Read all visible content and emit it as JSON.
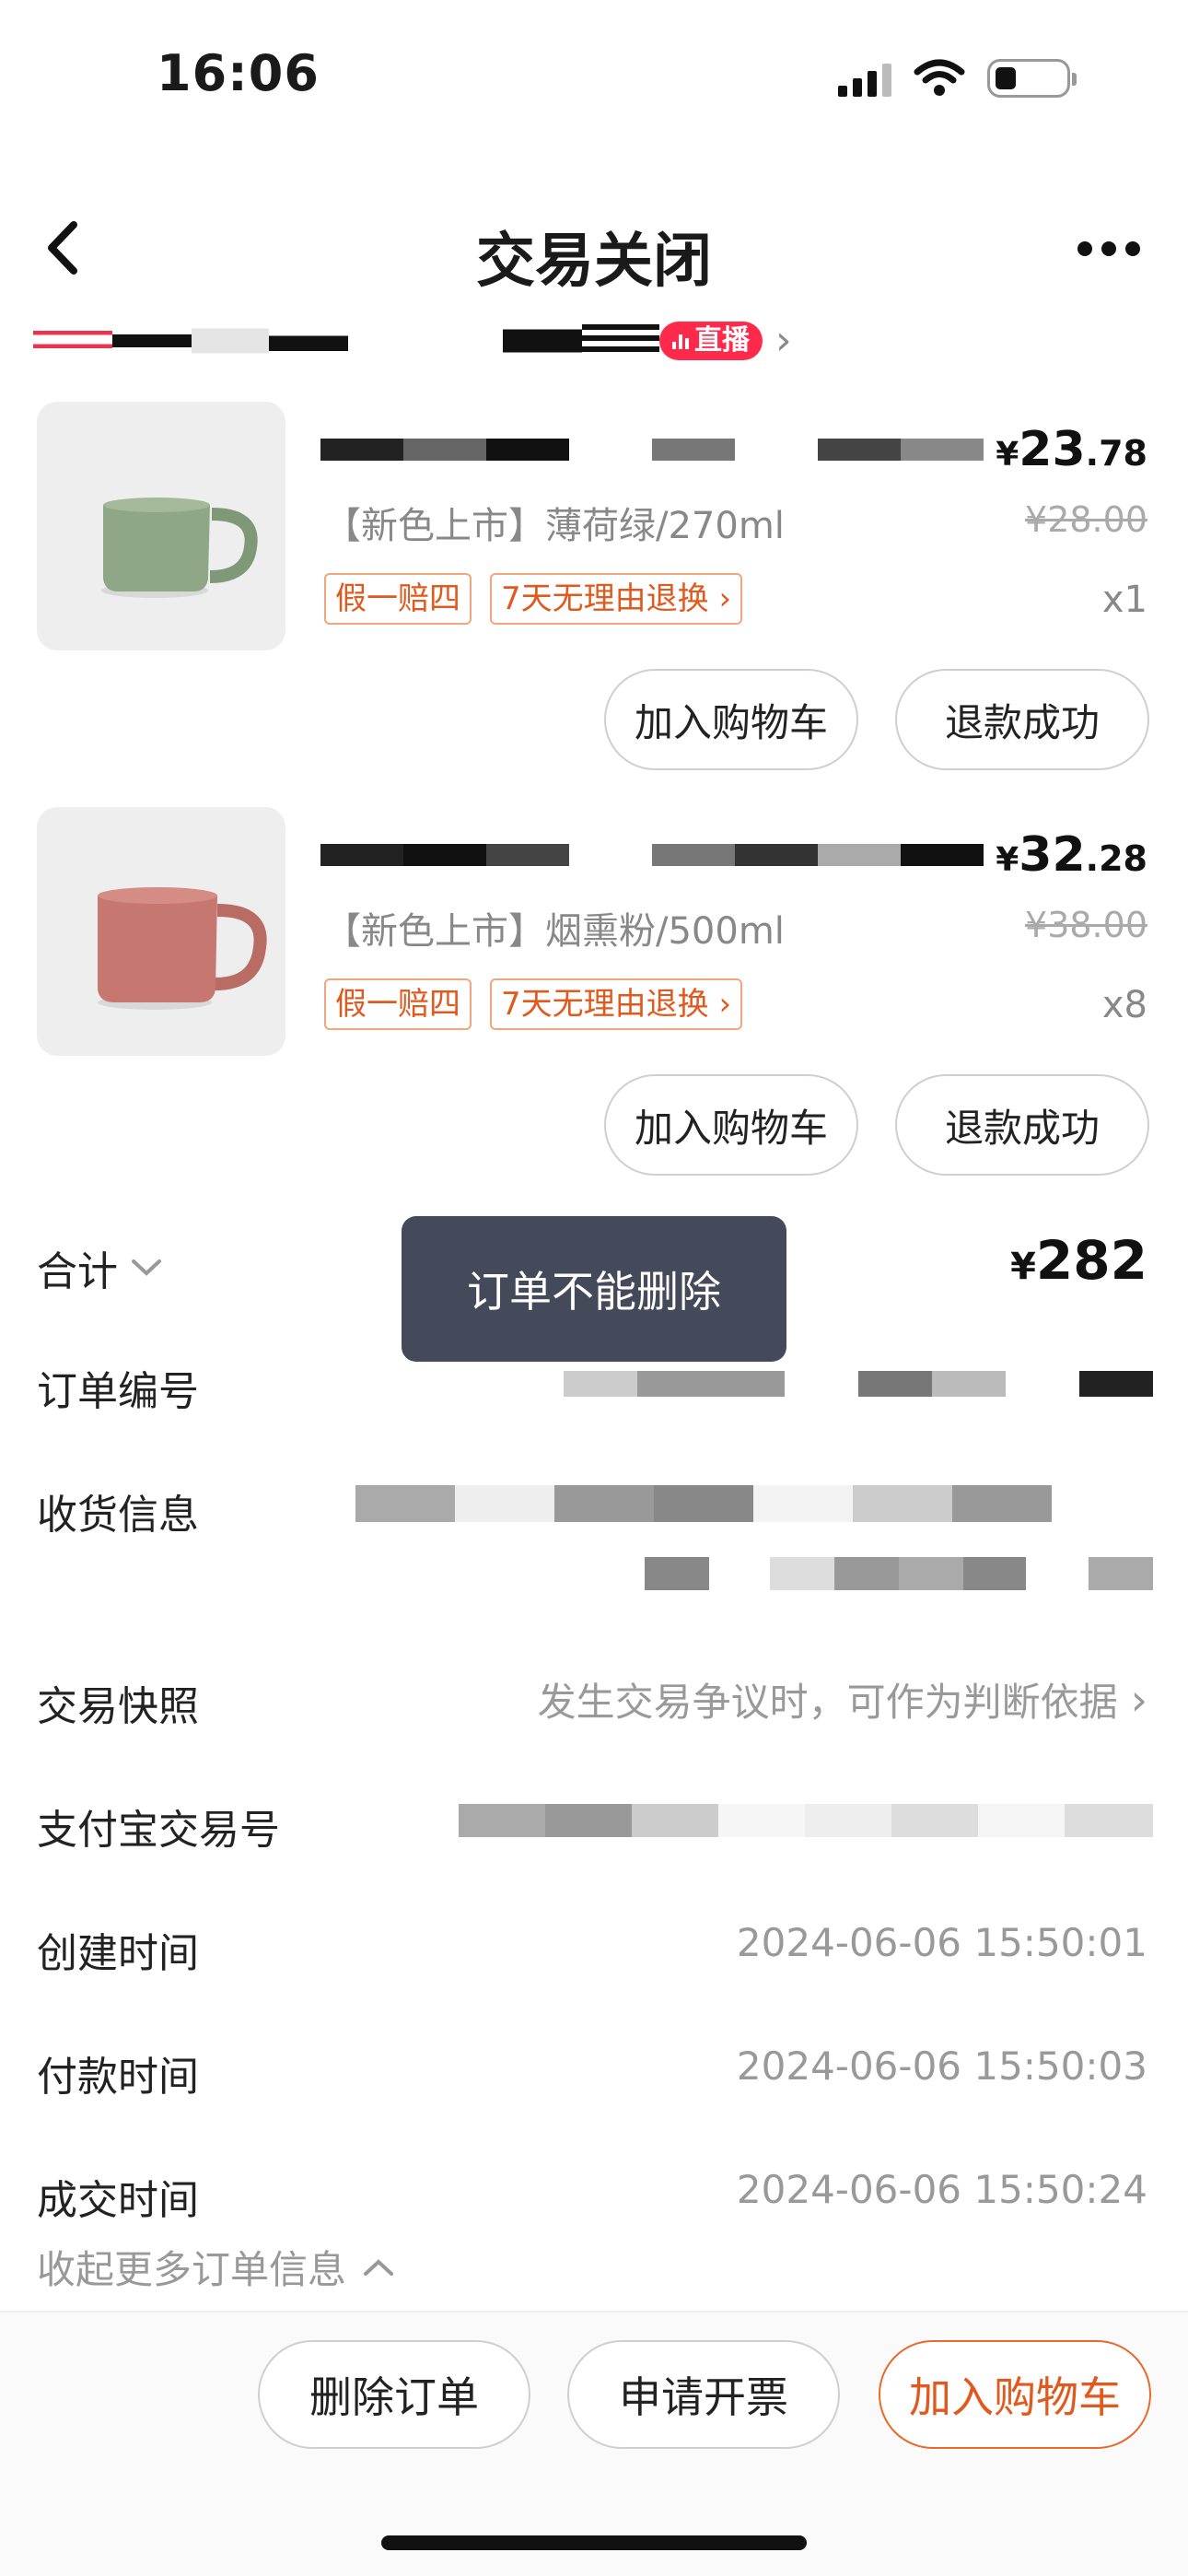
{
  "status_bar": {
    "time": "16:06"
  },
  "nav": {
    "title": "交易关闭"
  },
  "shop": {
    "live_badge": "直播"
  },
  "products": [
    {
      "price_yen": "¥",
      "price_int": "23",
      "price_dec": ".78",
      "spec": "【新色上市】薄荷绿/270ml",
      "original_price": "¥28.00",
      "tag_1": "假一赔四",
      "tag_2": "7天无理由退换",
      "qty": "x1",
      "add_cart_label": "加入购物车",
      "refund_label": "退款成功",
      "mug_color": "#8fa786"
    },
    {
      "price_yen": "¥",
      "price_int": "32",
      "price_dec": ".28",
      "spec": "【新色上市】烟熏粉/500ml",
      "original_price": "¥38.00",
      "tag_1": "假一赔四",
      "tag_2": "7天无理由退换",
      "qty": "x8",
      "add_cart_label": "加入购物车",
      "refund_label": "退款成功",
      "mug_color": "#c67870"
    }
  ],
  "total": {
    "label": "合计",
    "yen": "¥",
    "amount": "282"
  },
  "toast": {
    "text": "订单不能删除"
  },
  "info": {
    "order_no_label": "订单编号",
    "address_label": "收货信息",
    "snapshot_label": "交易快照",
    "snapshot_value": "发生交易争议时，可作为判断依据",
    "alipay_label": "支付宝交易号",
    "created_label": "创建时间",
    "created_value": "2024-06-06 15:50:01",
    "paid_label": "付款时间",
    "paid_value": "2024-06-06 15:50:03",
    "deal_label": "成交时间",
    "deal_value": "2024-06-06 15:50:24",
    "collapse_label": "收起更多订单信息"
  },
  "bottom_bar": {
    "delete_label": "删除订单",
    "invoice_label": "申请开票",
    "add_cart_label": "加入购物车"
  },
  "colors": {
    "accent": "#e2591d",
    "live_badge": "#ff2a4b",
    "toast_bg": "#444a5a"
  }
}
